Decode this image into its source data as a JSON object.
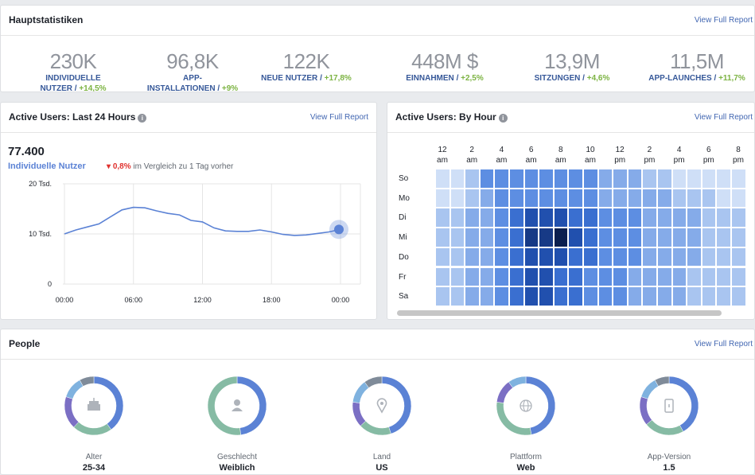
{
  "main_stats": {
    "title": "Hauptstatistiken",
    "link": "View Full Report",
    "items": [
      {
        "value": "230K",
        "label": "INDIVIDUELLE",
        "label2": "NUTZER",
        "change": "+14,5%"
      },
      {
        "value": "96,8K",
        "label": "APP-",
        "label2": "INSTALLATIONEN",
        "change": "+9%"
      },
      {
        "value": "122K",
        "label": "NEUE NUTZER",
        "label2": "",
        "change": "+17,8%"
      },
      {
        "value": "448M $",
        "label": "EINNAHMEN",
        "label2": "",
        "change": "+2,5%"
      },
      {
        "value": "13,9M",
        "label": "SITZUNGEN",
        "label2": "",
        "change": "+4,6%"
      },
      {
        "value": "11,5M",
        "label": "APP-LAUNCHES",
        "label2": "",
        "change": "+11,7%"
      }
    ],
    "separator": "/"
  },
  "active_24h": {
    "title": "Active Users: Last 24 Hours",
    "link": "View Full Report",
    "big_number": "77.400",
    "metric_label": "Individuelle Nutzer",
    "change_arrow": "▾",
    "change": "0,8%",
    "compare_text": "im Vergleich zu 1 Tag vorher"
  },
  "chart_data": {
    "type": "line",
    "x": [
      "00:00",
      "01:00",
      "02:00",
      "03:00",
      "04:00",
      "05:00",
      "06:00",
      "07:00",
      "08:00",
      "09:00",
      "10:00",
      "11:00",
      "12:00",
      "13:00",
      "14:00",
      "15:00",
      "16:00",
      "17:00",
      "18:00",
      "19:00",
      "20:00",
      "21:00",
      "22:00",
      "23:00",
      "24:00"
    ],
    "y": [
      10000,
      10800,
      11400,
      12000,
      13400,
      14800,
      15300,
      15200,
      14600,
      14100,
      13800,
      12700,
      12400,
      11200,
      10600,
      10500,
      10500,
      10800,
      10400,
      9900,
      9700,
      9800,
      10100,
      10400,
      10900
    ],
    "yticks": [
      "0",
      "10 Tsd.",
      "20 Tsd."
    ],
    "ytick_values": [
      0,
      10000,
      20000
    ],
    "xticks": [
      "00:00",
      "06:00",
      "12:00",
      "18:00",
      "00:00"
    ],
    "xtick_positions": [
      0,
      6,
      12,
      18,
      24
    ],
    "ylim": [
      0,
      20000
    ],
    "grid": true,
    "color": "#5b82d5"
  },
  "by_hour": {
    "title": "Active Users: By Hour",
    "link": "View Full Report",
    "columns": [
      {
        "h": "12",
        "p": "am"
      },
      {
        "h": "2",
        "p": "am"
      },
      {
        "h": "4",
        "p": "am"
      },
      {
        "h": "6",
        "p": "am"
      },
      {
        "h": "8",
        "p": "am"
      },
      {
        "h": "10",
        "p": "am"
      },
      {
        "h": "12",
        "p": "pm"
      },
      {
        "h": "2",
        "p": "pm"
      },
      {
        "h": "4",
        "p": "pm"
      },
      {
        "h": "6",
        "p": "pm"
      },
      {
        "h": "8",
        "p": "pm"
      }
    ],
    "rows": [
      "So",
      "Mo",
      "Di",
      "Mi",
      "Do",
      "Fr",
      "Sa"
    ],
    "intensity": [
      [
        1,
        1,
        2,
        4,
        4,
        4,
        4,
        4,
        4,
        4,
        4,
        3,
        3,
        3,
        2,
        2,
        1,
        1,
        1,
        1,
        1,
        1
      ],
      [
        1,
        1,
        2,
        3,
        4,
        4,
        4,
        4,
        4,
        4,
        4,
        3,
        3,
        3,
        3,
        3,
        2,
        2,
        2,
        1,
        1,
        1
      ],
      [
        2,
        2,
        3,
        3,
        4,
        5,
        6,
        6,
        6,
        5,
        5,
        4,
        4,
        4,
        3,
        3,
        3,
        3,
        2,
        2,
        2,
        2
      ],
      [
        2,
        2,
        3,
        3,
        4,
        5,
        7,
        7,
        8,
        6,
        5,
        4,
        4,
        4,
        3,
        3,
        3,
        3,
        2,
        2,
        2,
        2
      ],
      [
        2,
        2,
        3,
        3,
        4,
        5,
        6,
        6,
        6,
        5,
        5,
        4,
        4,
        4,
        3,
        3,
        3,
        3,
        2,
        2,
        2,
        2
      ],
      [
        2,
        2,
        3,
        3,
        4,
        5,
        6,
        6,
        5,
        5,
        4,
        4,
        4,
        3,
        3,
        3,
        3,
        2,
        2,
        2,
        2,
        2
      ],
      [
        2,
        2,
        3,
        3,
        4,
        5,
        6,
        6,
        5,
        5,
        4,
        4,
        4,
        3,
        3,
        3,
        3,
        2,
        2,
        2,
        2,
        2
      ]
    ]
  },
  "people": {
    "title": "People",
    "link": "View Full Report",
    "donuts": [
      {
        "label": "Alter",
        "value": "25-34",
        "icon": "cake-icon",
        "segments": [
          {
            "pct": 40,
            "color": "#5b82d5"
          },
          {
            "pct": 22,
            "color": "#86bba4"
          },
          {
            "pct": 18,
            "color": "#7b6fc4"
          },
          {
            "pct": 12,
            "color": "#7fb2df"
          },
          {
            "pct": 8,
            "color": "#7f8b99"
          }
        ]
      },
      {
        "label": "Geschlecht",
        "value": "Weiblich",
        "icon": "person-icon",
        "segments": [
          {
            "pct": 48,
            "color": "#5b82d5"
          },
          {
            "pct": 52,
            "color": "#86bba4"
          }
        ]
      },
      {
        "label": "Land",
        "value": "US",
        "icon": "location-pin-icon",
        "segments": [
          {
            "pct": 45,
            "color": "#5b82d5"
          },
          {
            "pct": 18,
            "color": "#86bba4"
          },
          {
            "pct": 14,
            "color": "#7b6fc4"
          },
          {
            "pct": 13,
            "color": "#7fb2df"
          },
          {
            "pct": 10,
            "color": "#7f8b99"
          }
        ]
      },
      {
        "label": "Plattform",
        "value": "Web",
        "icon": "globe-icon",
        "segments": [
          {
            "pct": 47,
            "color": "#5b82d5"
          },
          {
            "pct": 30,
            "color": "#86bba4"
          },
          {
            "pct": 13,
            "color": "#7b6fc4"
          },
          {
            "pct": 10,
            "color": "#7fb2df"
          }
        ]
      },
      {
        "label": "App-Version",
        "value": "1.5",
        "icon": "phone-icon",
        "segments": [
          {
            "pct": 42,
            "color": "#5b82d5"
          },
          {
            "pct": 22,
            "color": "#86bba4"
          },
          {
            "pct": 16,
            "color": "#7b6fc4"
          },
          {
            "pct": 12,
            "color": "#7fb2df"
          },
          {
            "pct": 8,
            "color": "#7f8b99"
          }
        ]
      }
    ]
  }
}
